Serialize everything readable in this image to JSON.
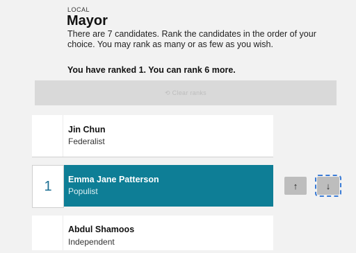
{
  "contest": {
    "kind": "LOCAL",
    "title": "Mayor",
    "instructions": "There are 7 candidates. Rank the candidates in the order of your choice. You may rank as many or as few as you wish.",
    "rank_status": "You have ranked 1. You can rank 6 more."
  },
  "clear_bar": {
    "label": "⟲ Clear ranks"
  },
  "candidates": [
    {
      "name": "Jin Chun",
      "party": "Federalist",
      "rank": ""
    },
    {
      "name": "Emma Jane Patterson",
      "party": "Populist",
      "rank": "1"
    },
    {
      "name": "Abdul Shamoos",
      "party": "Independent",
      "rank": ""
    }
  ],
  "controls": {
    "move_up_icon": "arrow-up-icon",
    "move_down_icon": "arrow-down-icon",
    "up_glyph": "↑",
    "down_glyph": "↓"
  },
  "colors": {
    "selected_background": "#0e7e96",
    "rank_number": "#1b6f93",
    "focus_outline": "#3a7bd5"
  }
}
